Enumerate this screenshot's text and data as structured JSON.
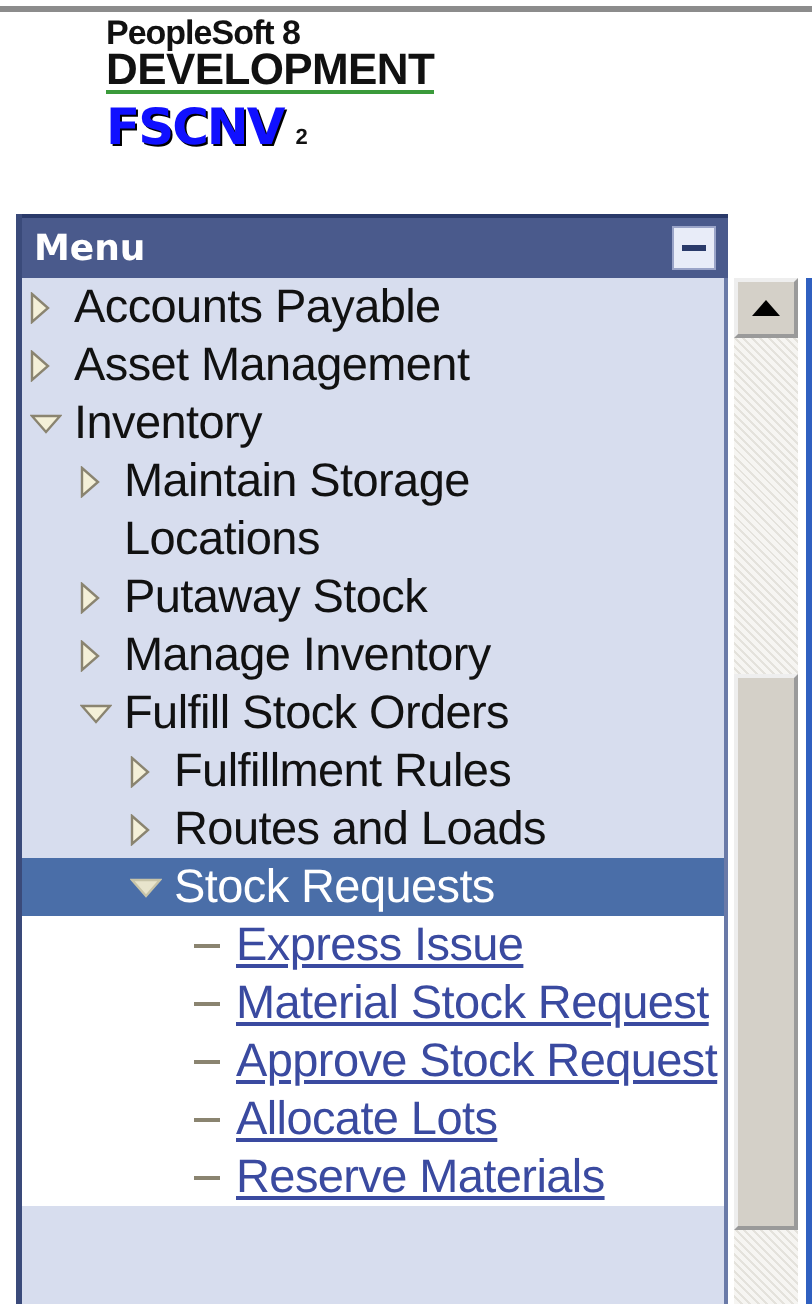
{
  "logo": {
    "product": "PeopleSoft 8",
    "environment": "DEVELOPMENT",
    "database": "FSCNV",
    "instance": "2"
  },
  "menu": {
    "title": "Menu",
    "collapsed": false,
    "items": [
      {
        "label": "Accounts Payable",
        "kind": "folder",
        "expanded": false,
        "selected": false
      },
      {
        "label": "Asset Management",
        "kind": "folder",
        "expanded": false,
        "selected": false
      },
      {
        "label": "Inventory",
        "kind": "folder",
        "expanded": true,
        "selected": false,
        "children": [
          {
            "label": "Maintain Storage Locations",
            "kind": "folder",
            "expanded": false,
            "selected": false
          },
          {
            "label": "Putaway Stock",
            "kind": "folder",
            "expanded": false,
            "selected": false
          },
          {
            "label": "Manage Inventory",
            "kind": "folder",
            "expanded": false,
            "selected": false
          },
          {
            "label": "Fulfill Stock Orders",
            "kind": "folder",
            "expanded": true,
            "selected": false,
            "children": [
              {
                "label": "Fulfillment Rules",
                "kind": "folder",
                "expanded": false,
                "selected": false
              },
              {
                "label": "Routes and Loads",
                "kind": "folder",
                "expanded": false,
                "selected": false
              },
              {
                "label": "Stock Requests",
                "kind": "folder",
                "expanded": true,
                "selected": true,
                "children": [
                  {
                    "label": "Express Issue",
                    "kind": "link",
                    "selected": false
                  },
                  {
                    "label": "Material Stock Request",
                    "kind": "link",
                    "selected": false
                  },
                  {
                    "label": "Approve Stock Request",
                    "kind": "link",
                    "selected": false
                  },
                  {
                    "label": "Allocate Lots",
                    "kind": "link",
                    "selected": false
                  },
                  {
                    "label": "Reserve Materials",
                    "kind": "link",
                    "selected": false
                  }
                ]
              }
            ]
          }
        ]
      }
    ]
  }
}
